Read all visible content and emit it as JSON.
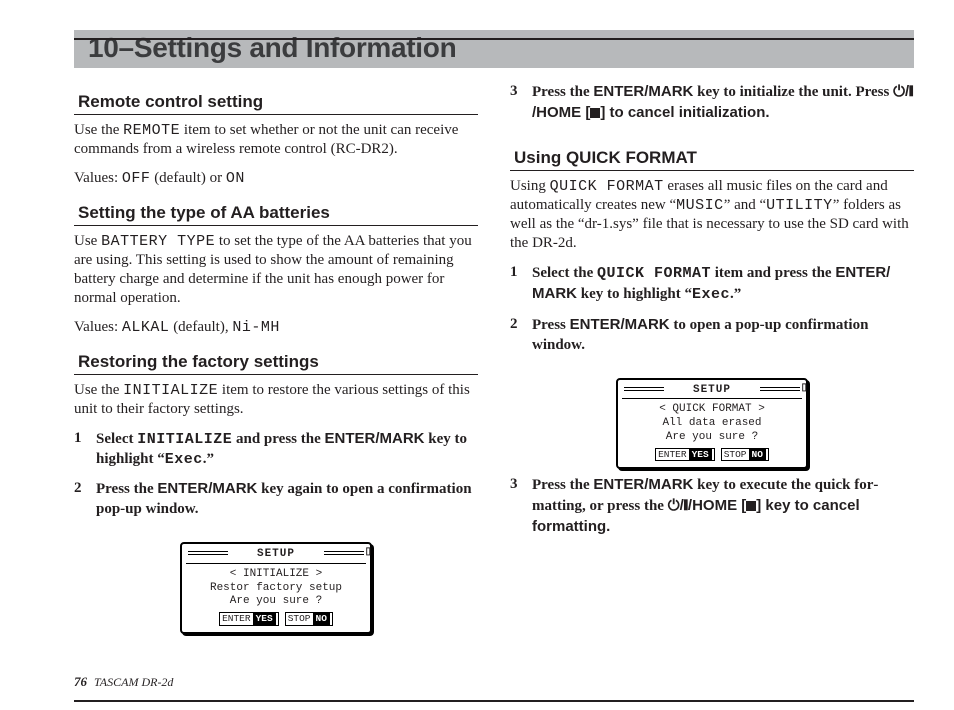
{
  "banner": {
    "title": "10–Settings and Information"
  },
  "left": {
    "remote": {
      "heading": "Remote control setting",
      "p1a": "Use the ",
      "p1_code": "REMOTE",
      "p1b": " item to set whether or not the unit can receive commands from a wireless remote control (RC-DR2).",
      "p2a": "Values: ",
      "p2_off": "OFF",
      "p2_mid": " (default) or ",
      "p2_on": "ON"
    },
    "battery": {
      "heading": "Setting the type of AA batteries",
      "p1a": "Use ",
      "p1_code": "BATTERY TYPE",
      "p1b": " to set the type of the AA batteries that you are using. This setting is used to show the amount of remaining battery charge and determine if the unit has enough power for normal operation.",
      "p2a": "Values: ",
      "p2_alk": "ALKAL",
      "p2_mid": " (default), ",
      "p2_nimh": "Ni-MH"
    },
    "restore": {
      "heading": "Restoring the factory settings",
      "p1a": "Use the ",
      "p1_code": "INITIALIZE",
      "p1b": " item to restore the various settings of this unit to their factory settings.",
      "step1a": "Select ",
      "step1_code": "INITIALIZE",
      "step1b": " and press the ",
      "step1_key": "ENTER/MARK",
      "step1c": " key to highlight “",
      "step1_exec": "Exec",
      "step1d": ".”",
      "step2a": "Press the ",
      "step2_key": "ENTER/MARK",
      "step2b": " key again to open a confirma­tion pop-up window."
    },
    "screen1": {
      "title": "SETUP",
      "line1": "< INITIALIZE >",
      "line2": "Restor factory setup",
      "line3": "Are you sure ?",
      "btnL_lbl": "ENTER",
      "btnL_val": "YES",
      "btnR_lbl": "STOP",
      "btnR_val": "NO"
    }
  },
  "right": {
    "restore_step3": {
      "a": "Press the ",
      "key1": "ENTER/MARK",
      "b": " key to initialize the unit. Press ",
      "pwr": "⏻/❙",
      "home": "/HOME [",
      "stop_icon": "stop",
      "c": "] to cancel initialization."
    },
    "quick": {
      "heading": "Using QUICK FORMAT",
      "p1a": "Using ",
      "p1_code": "QUICK FORMAT",
      "p1b": " erases all music files on the card and automatically creates new “",
      "p1_music": "MUSIC",
      "p1c": "” and “",
      "p1_util": "UTILITY",
      "p1d": "” folders as well as the “dr-1.sys” file that is necessary to use the SD card with the DR-2d.",
      "step1a": "Select the ",
      "step1_code": "QUICK FORMAT",
      "step1b": " item and press the ",
      "step1_key": "ENTER/ MARK",
      "step1c": " key to highlight “",
      "step1_exec": "Exec",
      "step1d": ".”",
      "step2a": "Press ",
      "step2_key": "ENTER/MARK",
      "step2b": " to open a pop-up confirmation window."
    },
    "screen2": {
      "title": "SETUP",
      "line1": "< QUICK FORMAT >",
      "line2": "All data erased",
      "line3": "Are you sure ?",
      "btnL_lbl": "ENTER",
      "btnL_val": "YES",
      "btnR_lbl": "STOP",
      "btnR_val": "NO"
    },
    "quick_step3": {
      "a": "Press the ",
      "key1": "ENTER/MARK",
      "b": " key to execute the quick for­matting, or press the ",
      "pwr": "⏻/❙",
      "home": "/HOME [",
      "stop_icon": "stop",
      "c": "] key to cancel formatting."
    }
  },
  "footer": {
    "page": "76",
    "model": "TASCAM  DR-2d"
  }
}
